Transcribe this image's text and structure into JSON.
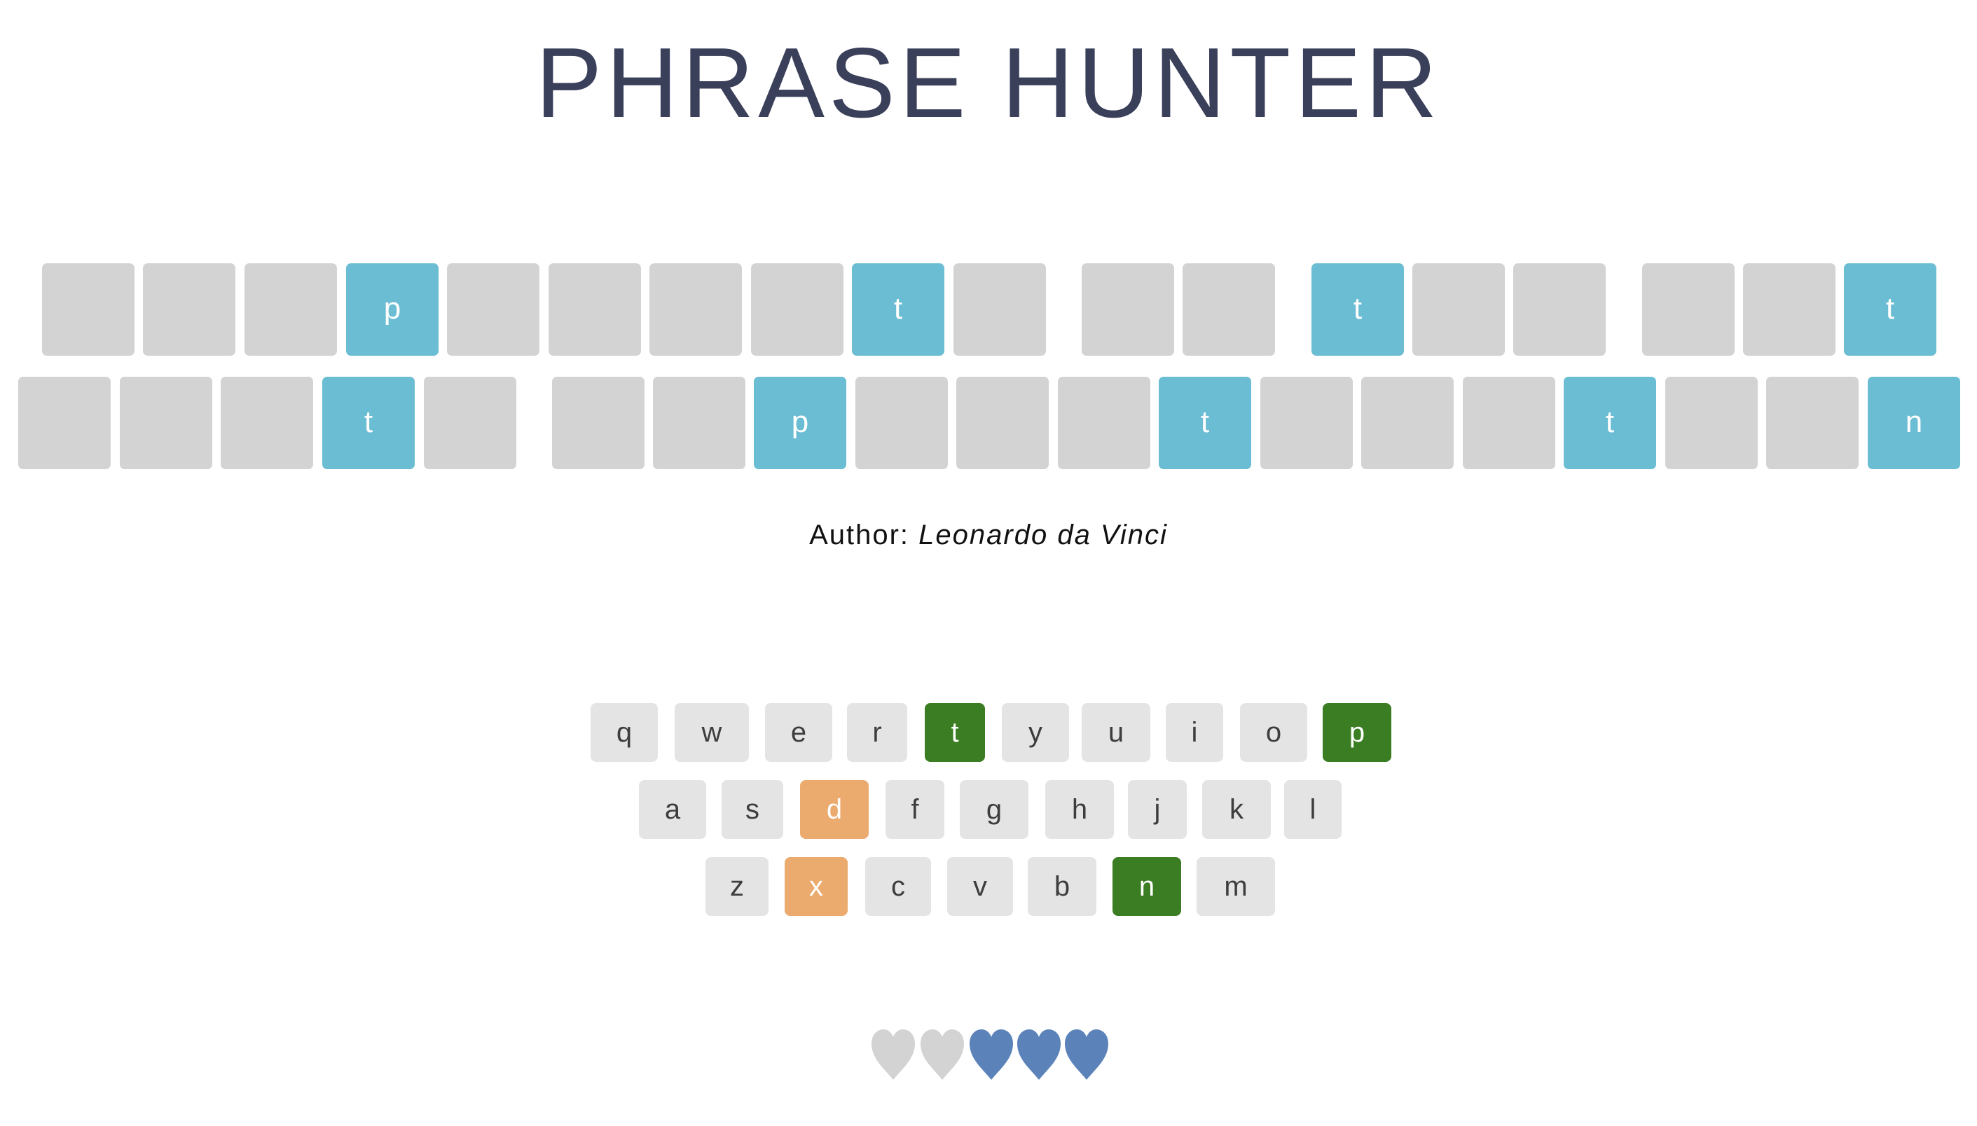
{
  "title": "PHRASE HUNTER",
  "author": {
    "label": "Author:",
    "name": "Leonardo da Vinci"
  },
  "phrase": {
    "row1": [
      {
        "letter": "",
        "shown": false
      },
      {
        "letter": "",
        "shown": false
      },
      {
        "letter": "",
        "shown": false
      },
      {
        "letter": "p",
        "shown": true
      },
      {
        "letter": "",
        "shown": false
      },
      {
        "letter": "",
        "shown": false
      },
      {
        "letter": "",
        "shown": false
      },
      {
        "letter": "",
        "shown": false
      },
      {
        "letter": "t",
        "shown": true
      },
      {
        "letter": "",
        "shown": false
      },
      {
        "letter": "",
        "shown": false
      },
      {
        "letter": "",
        "shown": false
      },
      {
        "letter": "t",
        "shown": true
      },
      {
        "letter": "",
        "shown": false
      },
      {
        "letter": "",
        "shown": false
      },
      {
        "letter": "",
        "shown": false
      },
      {
        "letter": "",
        "shown": false
      },
      {
        "letter": "t",
        "shown": true
      }
    ],
    "row2": [
      {
        "letter": "",
        "shown": false
      },
      {
        "letter": "",
        "shown": false
      },
      {
        "letter": "",
        "shown": false
      },
      {
        "letter": "t",
        "shown": true
      },
      {
        "letter": "",
        "shown": false
      },
      {
        "letter": "",
        "shown": false
      },
      {
        "letter": "",
        "shown": false
      },
      {
        "letter": "p",
        "shown": true
      },
      {
        "letter": "",
        "shown": false
      },
      {
        "letter": "",
        "shown": false
      },
      {
        "letter": "",
        "shown": false
      },
      {
        "letter": "t",
        "shown": true
      },
      {
        "letter": "",
        "shown": false
      },
      {
        "letter": "",
        "shown": false
      },
      {
        "letter": "",
        "shown": false
      },
      {
        "letter": "t",
        "shown": true
      },
      {
        "letter": "",
        "shown": false
      },
      {
        "letter": "",
        "shown": false
      },
      {
        "letter": "n",
        "shown": true
      }
    ]
  },
  "keyboard": {
    "row1": [
      {
        "key": "q",
        "state": "unused"
      },
      {
        "key": "w",
        "state": "unused"
      },
      {
        "key": "e",
        "state": "unused"
      },
      {
        "key": "r",
        "state": "unused"
      },
      {
        "key": "t",
        "state": "chosen"
      },
      {
        "key": "y",
        "state": "unused"
      },
      {
        "key": "u",
        "state": "unused"
      },
      {
        "key": "i",
        "state": "unused"
      },
      {
        "key": "o",
        "state": "unused"
      },
      {
        "key": "p",
        "state": "chosen"
      }
    ],
    "row2": [
      {
        "key": "a",
        "state": "unused"
      },
      {
        "key": "s",
        "state": "unused"
      },
      {
        "key": "d",
        "state": "wrong"
      },
      {
        "key": "f",
        "state": "unused"
      },
      {
        "key": "g",
        "state": "unused"
      },
      {
        "key": "h",
        "state": "unused"
      },
      {
        "key": "j",
        "state": "unused"
      },
      {
        "key": "k",
        "state": "unused"
      },
      {
        "key": "l",
        "state": "unused"
      }
    ],
    "row3": [
      {
        "key": "z",
        "state": "unused"
      },
      {
        "key": "x",
        "state": "wrong"
      },
      {
        "key": "c",
        "state": "unused"
      },
      {
        "key": "v",
        "state": "unused"
      },
      {
        "key": "b",
        "state": "unused"
      },
      {
        "key": "n",
        "state": "chosen"
      },
      {
        "key": "m",
        "state": "unused"
      }
    ]
  },
  "lives": {
    "total": 5,
    "remaining": 3,
    "lost_color": "#d3d3d3",
    "live_color": "#5b83ba"
  },
  "colors": {
    "tile_hidden": "#d3d3d3",
    "tile_shown": "#6bbdd3",
    "key_chosen": "#3a7d22",
    "key_wrong": "#ebab6f",
    "key_unused": "#e4e4e4",
    "title": "#3a3f5a"
  }
}
